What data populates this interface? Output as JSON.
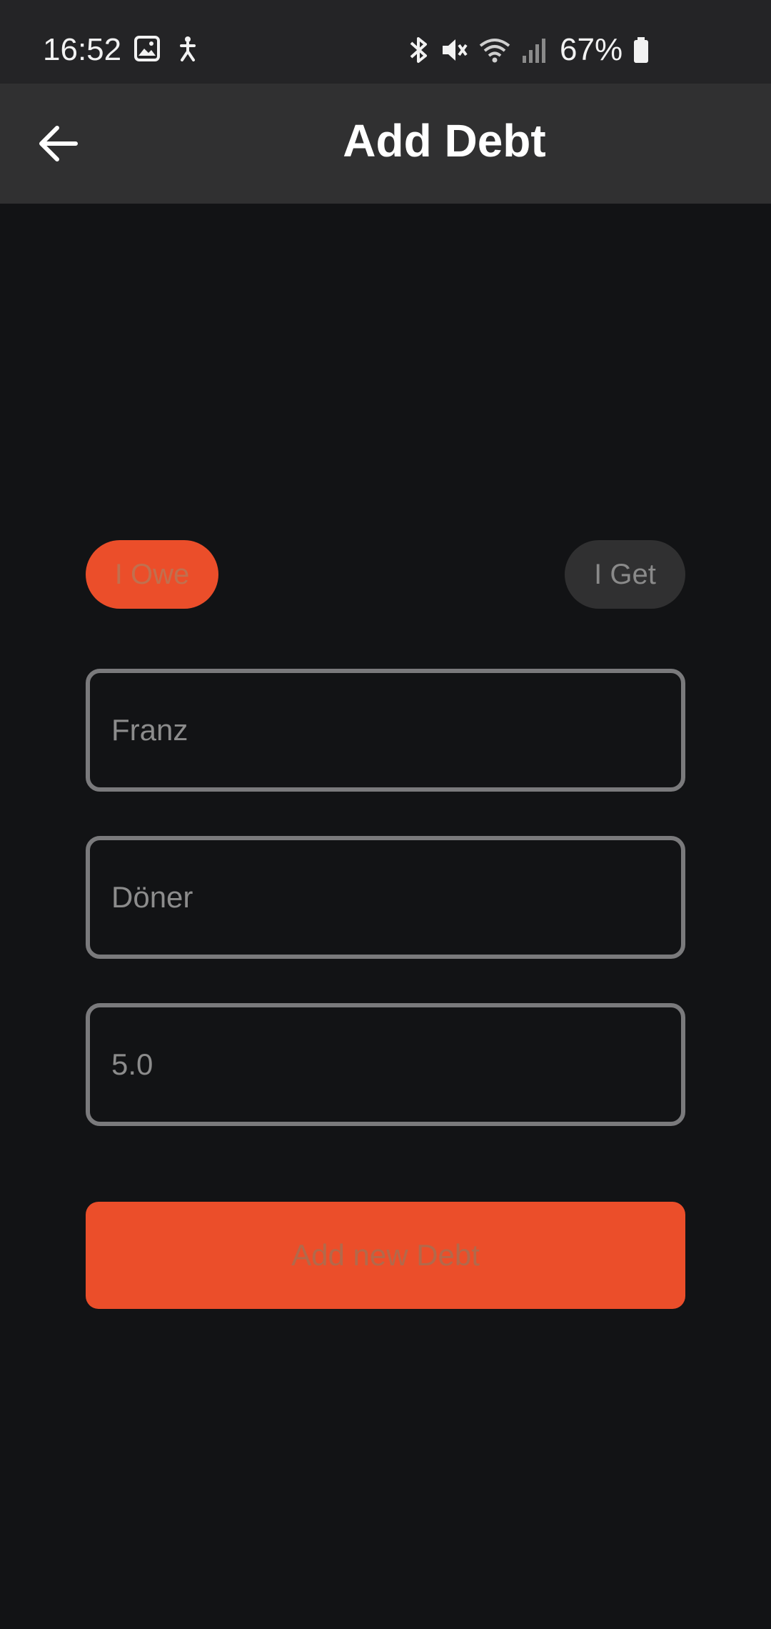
{
  "status_bar": {
    "time": "16:52",
    "battery_percent": "67%",
    "icons_left": [
      "gallery-icon",
      "accessibility-icon"
    ],
    "icons_right": [
      "bluetooth-icon",
      "mute-icon",
      "wifi-icon",
      "signal-icon",
      "battery-icon"
    ]
  },
  "app_bar": {
    "title": "Add Debt",
    "back_icon": "arrow-left-icon"
  },
  "debt_type": {
    "owe_label": "I Owe",
    "get_label": "I Get",
    "selected": "I Owe"
  },
  "form": {
    "name_value": "Franz",
    "description_value": "Döner",
    "amount_value": "5.0"
  },
  "submit": {
    "label": "Add new Debt"
  },
  "colors": {
    "accent": "#eb4e2a",
    "background": "#121315",
    "app_bar": "#303031",
    "status_bar": "#242426",
    "field_border": "#7a7a7c"
  }
}
